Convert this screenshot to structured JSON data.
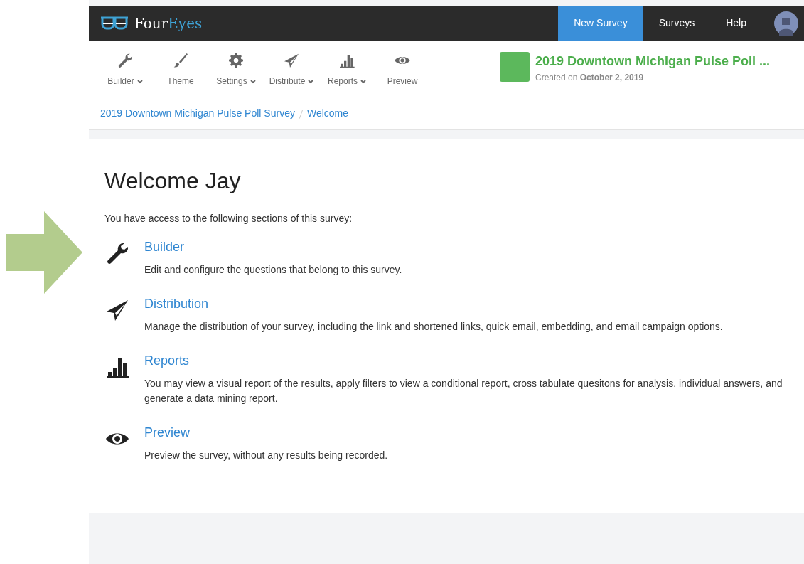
{
  "logo": {
    "word_1": "Four",
    "word_2": "Eyes"
  },
  "nav": [
    {
      "label": "New Survey",
      "selected": true
    },
    {
      "label": "Surveys",
      "selected": false
    },
    {
      "label": "Help",
      "selected": false
    }
  ],
  "toolbar": [
    {
      "label": "Builder",
      "dropdown": true
    },
    {
      "label": "Theme",
      "dropdown": false
    },
    {
      "label": "Settings",
      "dropdown": true
    },
    {
      "label": "Distribute",
      "dropdown": true
    },
    {
      "label": "Reports",
      "dropdown": true
    },
    {
      "label": "Preview",
      "dropdown": false
    }
  ],
  "survey": {
    "title": "2019 Downtown Michigan Pulse Poll ...",
    "created": "Created on **October 2, 2019**",
    "color": "#5cb85c"
  },
  "breadcrumb": [
    "2019 Downtown Michigan Pulse Poll Survey",
    "Welcome"
  ],
  "heading": "Welcome Jay",
  "intro": "You have access to the following sections of this survey:",
  "sections": [
    {
      "title": "Builder",
      "text": "Edit and configure the questions that belong to this survey."
    },
    {
      "title": "Distribution",
      "text": "Manage the distribution of your survey, including the link and shortened links, quick email, embedding, and email campaign options."
    },
    {
      "title": "Reports",
      "text": "You may view a visual report of the results, apply filters to view a conditional report, cross tabulate quesitons for analysis, individual answers, and generate a data mining report."
    },
    {
      "title": "Preview",
      "text": "Preview the survey, without any results being recorded."
    }
  ]
}
